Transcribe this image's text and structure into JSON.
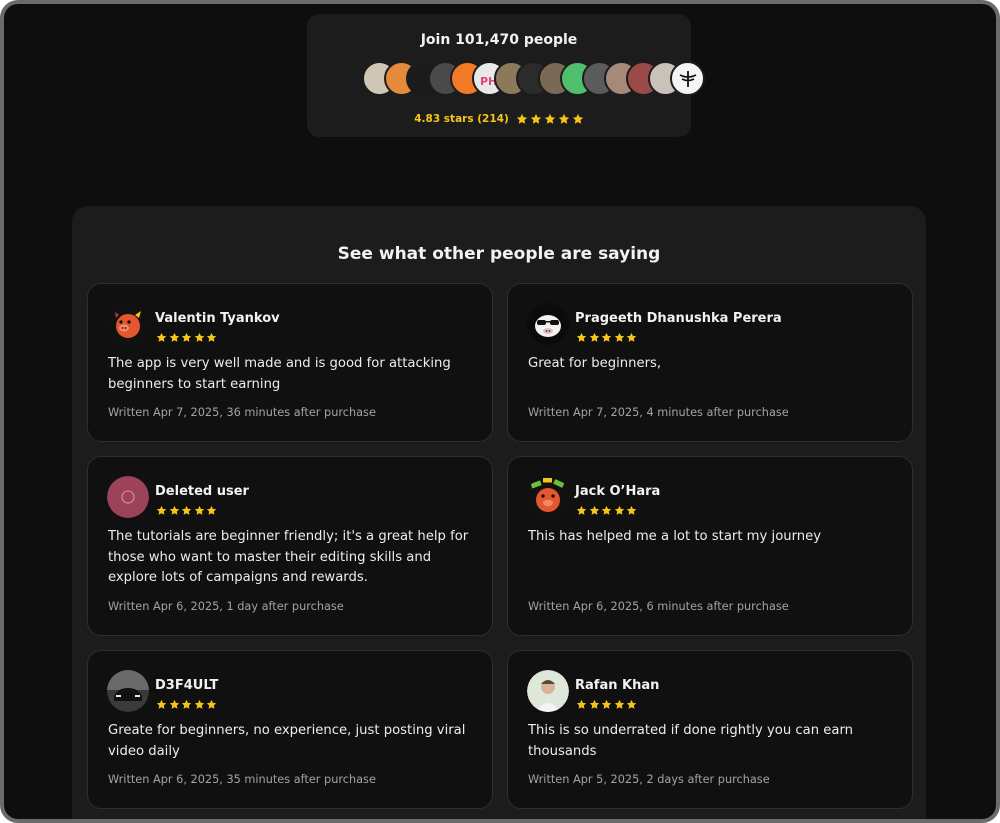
{
  "join": {
    "title": "Join 101,470 people",
    "rating_text": "4.83 stars (214)",
    "stars": 5,
    "avatar_colors": [
      "#cfc6b5",
      "#e58a3a",
      "#1b1b1b",
      "#4a4a4a",
      "#f07a26",
      "#e9e9e9",
      "#8a7a5a",
      "#2b2b2b",
      "#7a6a55",
      "#4fbf6e",
      "#5b5b5b",
      "#a58a7a",
      "#9b4a4a",
      "#c9c2b8",
      "#f5f5f5"
    ],
    "avatar_icons": [
      "avatar-image-icon",
      "ph-logo-icon",
      "bird-logo-icon"
    ]
  },
  "reviews": {
    "title": "See what other people are saying",
    "star_color": "#f5c518",
    "items": [
      {
        "name": "Valentin Tyankov",
        "stars": 5,
        "text": "The app is very well made and is good for attacking beginners to start earning",
        "written": "Written Apr 7, 2025, 36 minutes after purchase",
        "avatar": "pig-mascot-icon"
      },
      {
        "name": "Prageeth Dhanushka Perera",
        "stars": 5,
        "text": "Great for beginners,",
        "written": "Written Apr 7, 2025, 4 minutes after purchase",
        "avatar": "pig-sunglasses-icon"
      },
      {
        "name": "Deleted user",
        "stars": 5,
        "text": "The tutorials are beginner friendly; it's a great help for those who want to master their editing skills and explore lots of campaigns and rewards.",
        "written": "Written Apr 6, 2025, 1 day after purchase",
        "avatar": "deleted-user-avatar-icon"
      },
      {
        "name": "Jack O’Hara",
        "stars": 5,
        "text": "This has helped me a lot to start my journey",
        "written": "Written Apr 6, 2025, 6 minutes after purchase",
        "avatar": "pig-money-icon"
      },
      {
        "name": "D3F4ULT",
        "stars": 5,
        "text": "Greate for beginners, no experience, just posting viral video daily",
        "written": "Written Apr 6, 2025, 35 minutes after purchase",
        "avatar": "car-photo-icon"
      },
      {
        "name": "Rafan Khan",
        "stars": 5,
        "text": "This is so underrated if done rightly you can earn thousands",
        "written": "Written Apr 5, 2025, 2 days after purchase",
        "avatar": "person-photo-icon"
      }
    ]
  }
}
